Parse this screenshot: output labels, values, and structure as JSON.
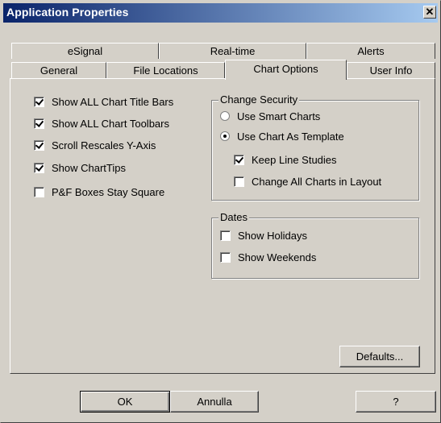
{
  "window": {
    "title": "Application Properties",
    "close_glyph": "✕"
  },
  "tabs": {
    "back_row": [
      "eSignal",
      "Real-time",
      "Alerts"
    ],
    "front_row": [
      "General",
      "File Locations",
      "Chart Options",
      "User Info"
    ],
    "active": "Chart Options"
  },
  "options": {
    "items": [
      {
        "label": "Show ALL Chart Title Bars",
        "checked": true
      },
      {
        "label": "Show ALL Chart Toolbars",
        "checked": true
      },
      {
        "label": "Scroll Rescales Y-Axis",
        "checked": true
      },
      {
        "label": "Show ChartTips",
        "checked": true
      },
      {
        "label": "P&F Boxes Stay Square",
        "checked": false
      }
    ]
  },
  "change_security": {
    "title": "Change Security",
    "radio_smart": "Use Smart Charts",
    "radio_template": "Use Chart As Template",
    "selected": "Use Chart As Template",
    "keep_line_studies": "Keep Line Studies",
    "keep_line_studies_checked": true,
    "change_all": "Change All Charts in Layout",
    "change_all_checked": false
  },
  "dates": {
    "title": "Dates",
    "show_holidays": "Show Holidays",
    "show_holidays_checked": false,
    "show_weekends": "Show Weekends",
    "show_weekends_checked": false
  },
  "buttons": {
    "defaults": "Defaults...",
    "ok": "OK",
    "cancel": "Annulla",
    "help": "?"
  }
}
